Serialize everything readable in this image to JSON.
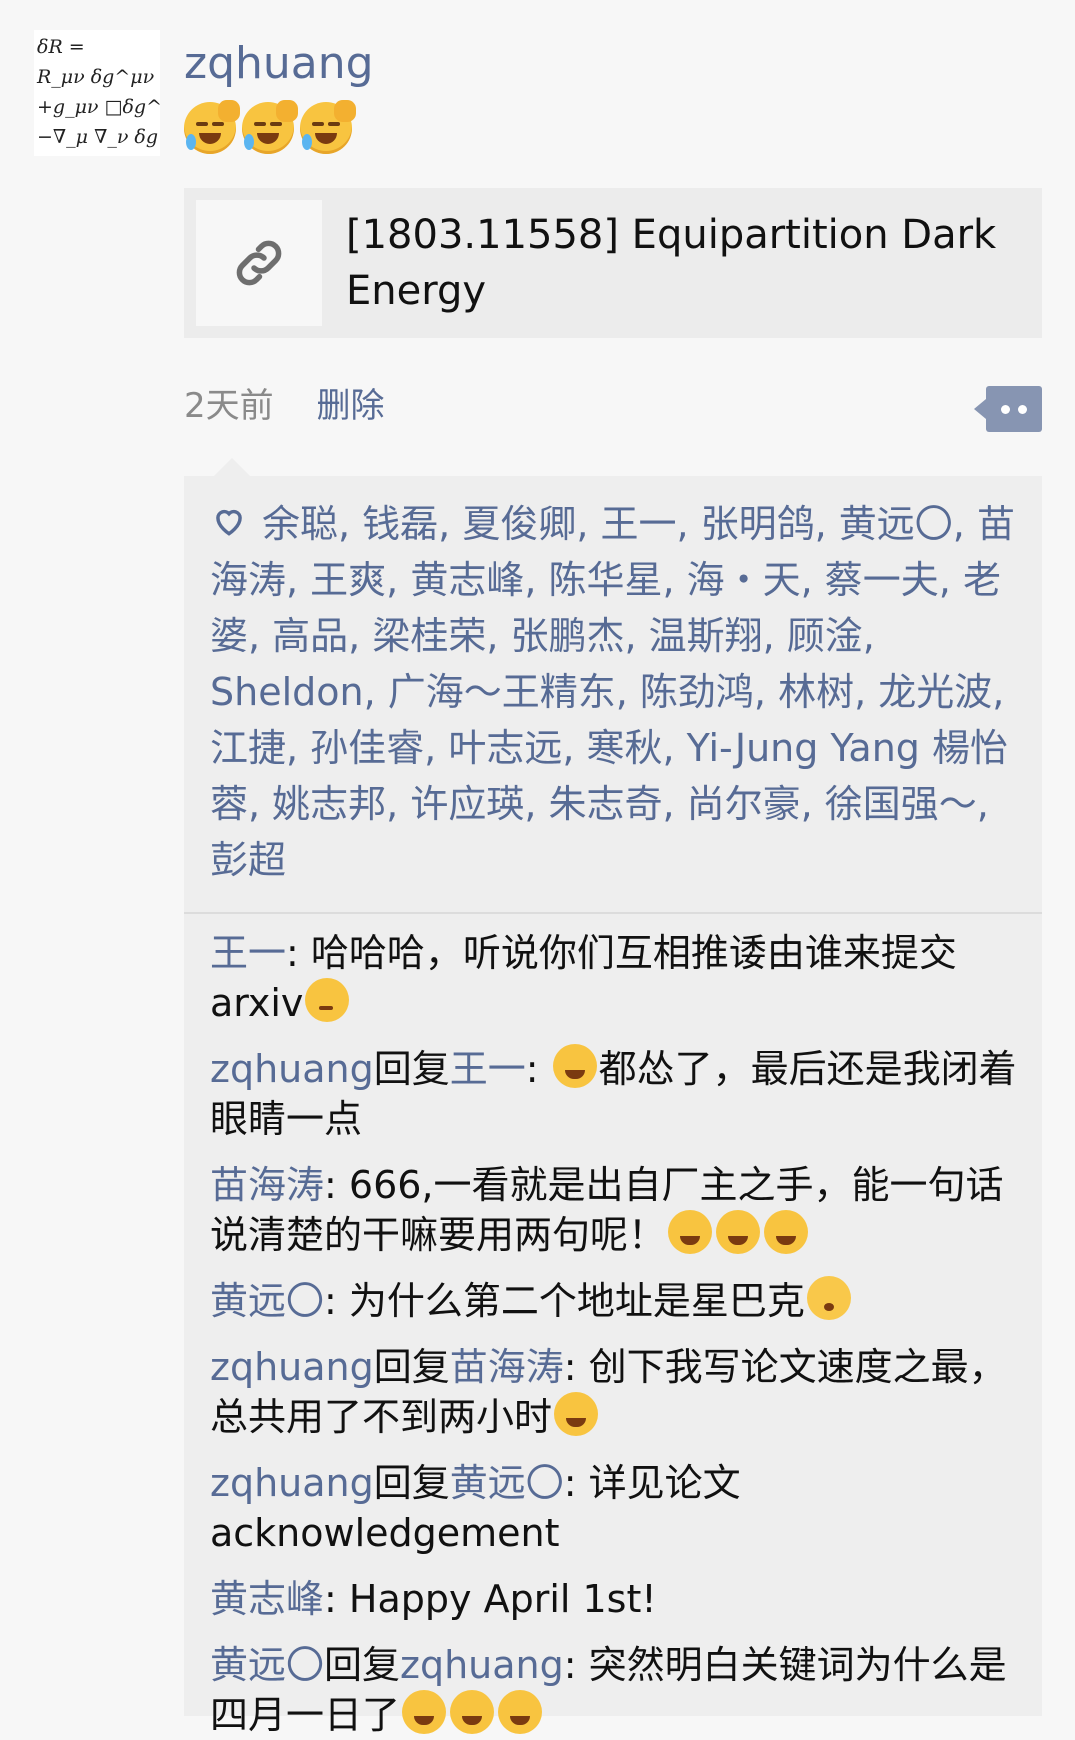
{
  "post": {
    "avatar_formula": [
      "δR =",
      "R_μν δg^μν",
      "+g_μν □δg^μν",
      "−∇_μ ∇_ν δg^μν"
    ],
    "username": "zqhuang",
    "emojis": [
      "face-palm-laughing",
      "face-palm-laughing",
      "face-palm-laughing"
    ],
    "link_card": {
      "icon": "link-icon",
      "title": "[1803.11558] Equipartition Dark Energy"
    },
    "time": "2天前",
    "delete_label": "删除",
    "more_icon": "more-dots-icon"
  },
  "likes": {
    "icon": "heart-outline-icon",
    "names": "余聪, 钱磊, 夏俊卿, 王一, 张明鸽, 黄远〇, 苗海涛, 王爽, 黄志峰, 陈华星, 海・天, 蔡一夫, 老婆, 高品, 梁桂荣, 张鹏杰, 温斯翔, 顾淦, Sheldon, 广海～王精东, 陈劲鸿, 林树, 龙光波, 江捷, 孙佳睿, 叶志远, 寒秋, Yi-Jung Yang 楊怡蓉, 姚志邦, 许应瑛, 朱志奇, 尚尔豪, 徐国强～, 彭超"
  },
  "comments": [
    {
      "author": "王一",
      "reply": "",
      "sep": ": ",
      "text": "哈哈哈，听说你们互相推诿由谁来提交arxiv",
      "emoji": [
        "thinking"
      ]
    },
    {
      "author": "zqhuang",
      "reply": "王一",
      "sep": ": ",
      "pre_emoji": [
        "tears-of-joy"
      ],
      "text": "都怂了，最后还是我闭着眼睛一点"
    },
    {
      "author": "苗海涛",
      "reply": "",
      "sep": ": ",
      "text": "666,一看就是出自厂主之手，能一句话说清楚的干嘛要用两句呢！",
      "emoji": [
        "tears-of-joy",
        "tears-of-joy",
        "tears-of-joy"
      ]
    },
    {
      "author": "黄远〇",
      "reply": "",
      "sep": ": ",
      "text": "为什么第二个地址是星巴克",
      "emoji": [
        "flushed"
      ]
    },
    {
      "author": "zqhuang",
      "reply": "苗海涛",
      "sep": ": ",
      "text": "创下我写论文速度之最，总共用了不到两小时",
      "emoji": [
        "tears-of-joy"
      ]
    },
    {
      "author": "zqhuang",
      "reply": "黄远〇",
      "sep": ": ",
      "text": "详见论文acknowledgement"
    },
    {
      "author": "黄志峰",
      "reply": "",
      "sep": ": ",
      "text": "Happy April 1st!"
    },
    {
      "author": "黄远〇",
      "reply": "zqhuang",
      "sep": ": ",
      "text": "突然明白关键词为什么是四月一日了",
      "emoji": [
        "tears-of-joy",
        "tears-of-joy",
        "tears-of-joy"
      ]
    }
  ],
  "reply_word": "回复",
  "colors": {
    "link_blue": "#576b95",
    "panel_bg": "#eeeeee",
    "page_bg": "#f7f7f7"
  }
}
